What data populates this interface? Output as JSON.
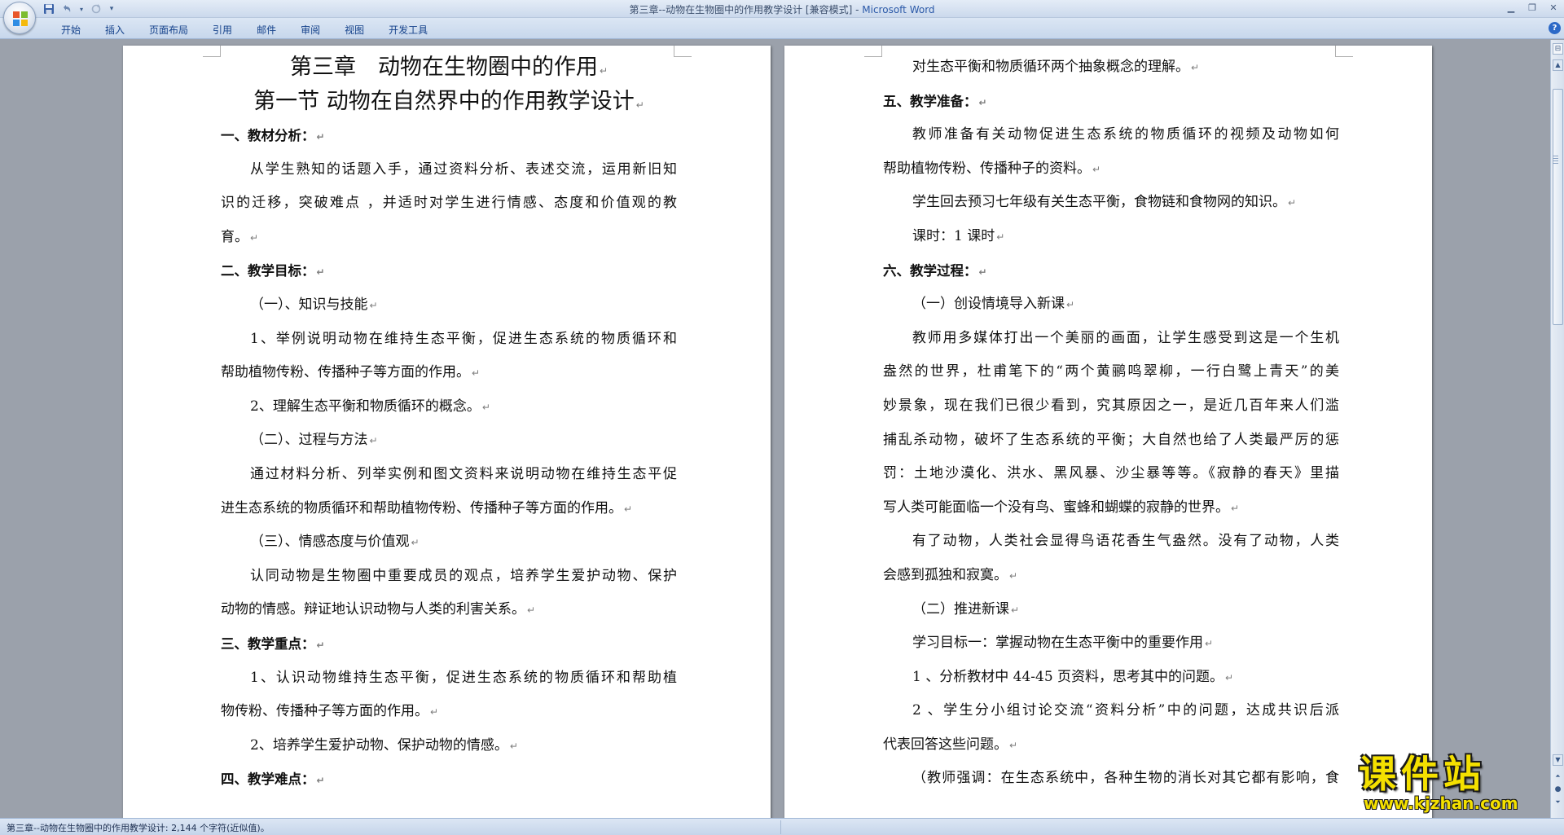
{
  "window": {
    "title": "第三章--动物在生物圈中的作用教学设计 [兼容模式]",
    "title_separator": " - ",
    "app_name": "Microsoft Word"
  },
  "qat": {
    "save_icon": "save-icon",
    "undo_icon": "undo-icon",
    "redo_icon": "redo-icon",
    "customize_icon": "dropdown-icon"
  },
  "ribbon": {
    "tabs": [
      "开始",
      "插入",
      "页面布局",
      "引用",
      "邮件",
      "审阅",
      "视图",
      "开发工具"
    ]
  },
  "pages": {
    "left": [
      {
        "text": "第三章　动物在生物圈中的作用",
        "style": "h1"
      },
      {
        "text": "第一节 动物在自然界中的作用教学设计",
        "style": "h1"
      },
      {
        "text": "一、教材分析：",
        "style": "sec"
      },
      {
        "text": "从学生熟知的话题入手，通过资料分析、表述交流，运用新旧知",
        "style": "ind just",
        "pm": false
      },
      {
        "text": "识的迁移，突破难点 ，并适时对学生进行情感、态度和价值观的教",
        "style": "just",
        "pm": false
      },
      {
        "text": "育。",
        "style": ""
      },
      {
        "text": "二、教学目标：",
        "style": "sec"
      },
      {
        "text": "（一）、知识与技能",
        "style": "ind"
      },
      {
        "text": "1、举例说明动物在维持生态平衡，促进生态系统的物质循环和",
        "style": "ind just",
        "pm": false
      },
      {
        "text": "帮助植物传粉、传播种子等方面的作用。",
        "style": ""
      },
      {
        "text": "2、理解生态平衡和物质循环的概念。",
        "style": "ind"
      },
      {
        "text": "（二）、过程与方法",
        "style": "ind"
      },
      {
        "text": "通过材料分析、列举实例和图文资料来说明动物在维持生态平促",
        "style": "ind just",
        "pm": false
      },
      {
        "text": "进生态系统的物质循环和帮助植物传粉、传播种子等方面的作用。",
        "style": ""
      },
      {
        "text": "（三）、情感态度与价值观",
        "style": "ind"
      },
      {
        "text": "认同动物是生物圈中重要成员的观点，培养学生爱护动物、保护",
        "style": "ind just",
        "pm": false
      },
      {
        "text": "动物的情感。辩证地认识动物与人类的利害关系。",
        "style": ""
      },
      {
        "text": "三、教学重点：",
        "style": "sec"
      },
      {
        "text": "1、认识动物维持生态平衡，促进生态系统的物质循环和帮助植",
        "style": "ind just",
        "pm": false
      },
      {
        "text": "物传粉、传播种子等方面的作用。",
        "style": ""
      },
      {
        "text": "2、培养学生爱护动物、保护动物的情感。",
        "style": "ind"
      },
      {
        "text": "四、教学难点：",
        "style": "sec"
      }
    ],
    "right": [
      {
        "text": "对生态平衡和物质循环两个抽象概念的理解。",
        "style": "ind"
      },
      {
        "text": "五、教学准备：",
        "style": "sec"
      },
      {
        "text": "教师准备有关动物促进生态系统的物质循环的视频及动物如何",
        "style": "ind just",
        "pm": false
      },
      {
        "text": "帮助植物传粉、传播种子的资料。",
        "style": ""
      },
      {
        "text": "学生回去预习七年级有关生态平衡，食物链和食物网的知识。",
        "style": "ind"
      },
      {
        "text": "课时：1 课时",
        "style": "ind"
      },
      {
        "text": "六、教学过程：",
        "style": "sec"
      },
      {
        "text": "（一）创设情境导入新课",
        "style": "ind"
      },
      {
        "text": "教师用多媒体打出一个美丽的画面，让学生感受到这是一个生机",
        "style": "ind just",
        "pm": false
      },
      {
        "text": "盎然的世界，杜甫笔下的“两个黄鹂鸣翠柳，一行白鹭上青天”的美",
        "style": "just",
        "pm": false
      },
      {
        "text": "妙景象，现在我们已很少看到，究其原因之一，是近几百年来人们滥",
        "style": "just",
        "pm": false
      },
      {
        "text": "捕乱杀动物，破坏了生态系统的平衡；大自然也给了人类最严厉的惩",
        "style": "just",
        "pm": false
      },
      {
        "text": "罚：土地沙漠化、洪水、黑风暴、沙尘暴等等。《寂静的春天》里描",
        "style": "just",
        "pm": false
      },
      {
        "text": "写人类可能面临一个没有鸟、蜜蜂和蝴蝶的寂静的世界。",
        "style": ""
      },
      {
        "text": "有了动物，人类社会显得鸟语花香生气盎然。没有了动物，人类",
        "style": "ind just",
        "pm": false
      },
      {
        "text": "会感到孤独和寂寞。",
        "style": ""
      },
      {
        "text": "（二）推进新课",
        "style": "ind"
      },
      {
        "text": "学习目标一：掌握动物在生态平衡中的重要作用",
        "style": "ind"
      },
      {
        "text": "1 、分析教材中 44-45 页资料，思考其中的问题。",
        "style": "ind"
      },
      {
        "text": "2 、学生分小组讨论交流“资料分析”中的问题，达成共识后派",
        "style": "ind just",
        "pm": false
      },
      {
        "text": "代表回答这些问题。",
        "style": ""
      },
      {
        "text": "（教师强调：在生态系统中，各种生物的消长对其它都有影响，食",
        "style": "ind just",
        "pm": false
      }
    ]
  },
  "paragraph_mark": "↵",
  "status": {
    "text": "第三章--动物在生物圈中的作用教学设计: 2,144 个字符(近似值)。"
  },
  "watermark": {
    "title": "课件站",
    "url": "www.kjzhan.com"
  }
}
